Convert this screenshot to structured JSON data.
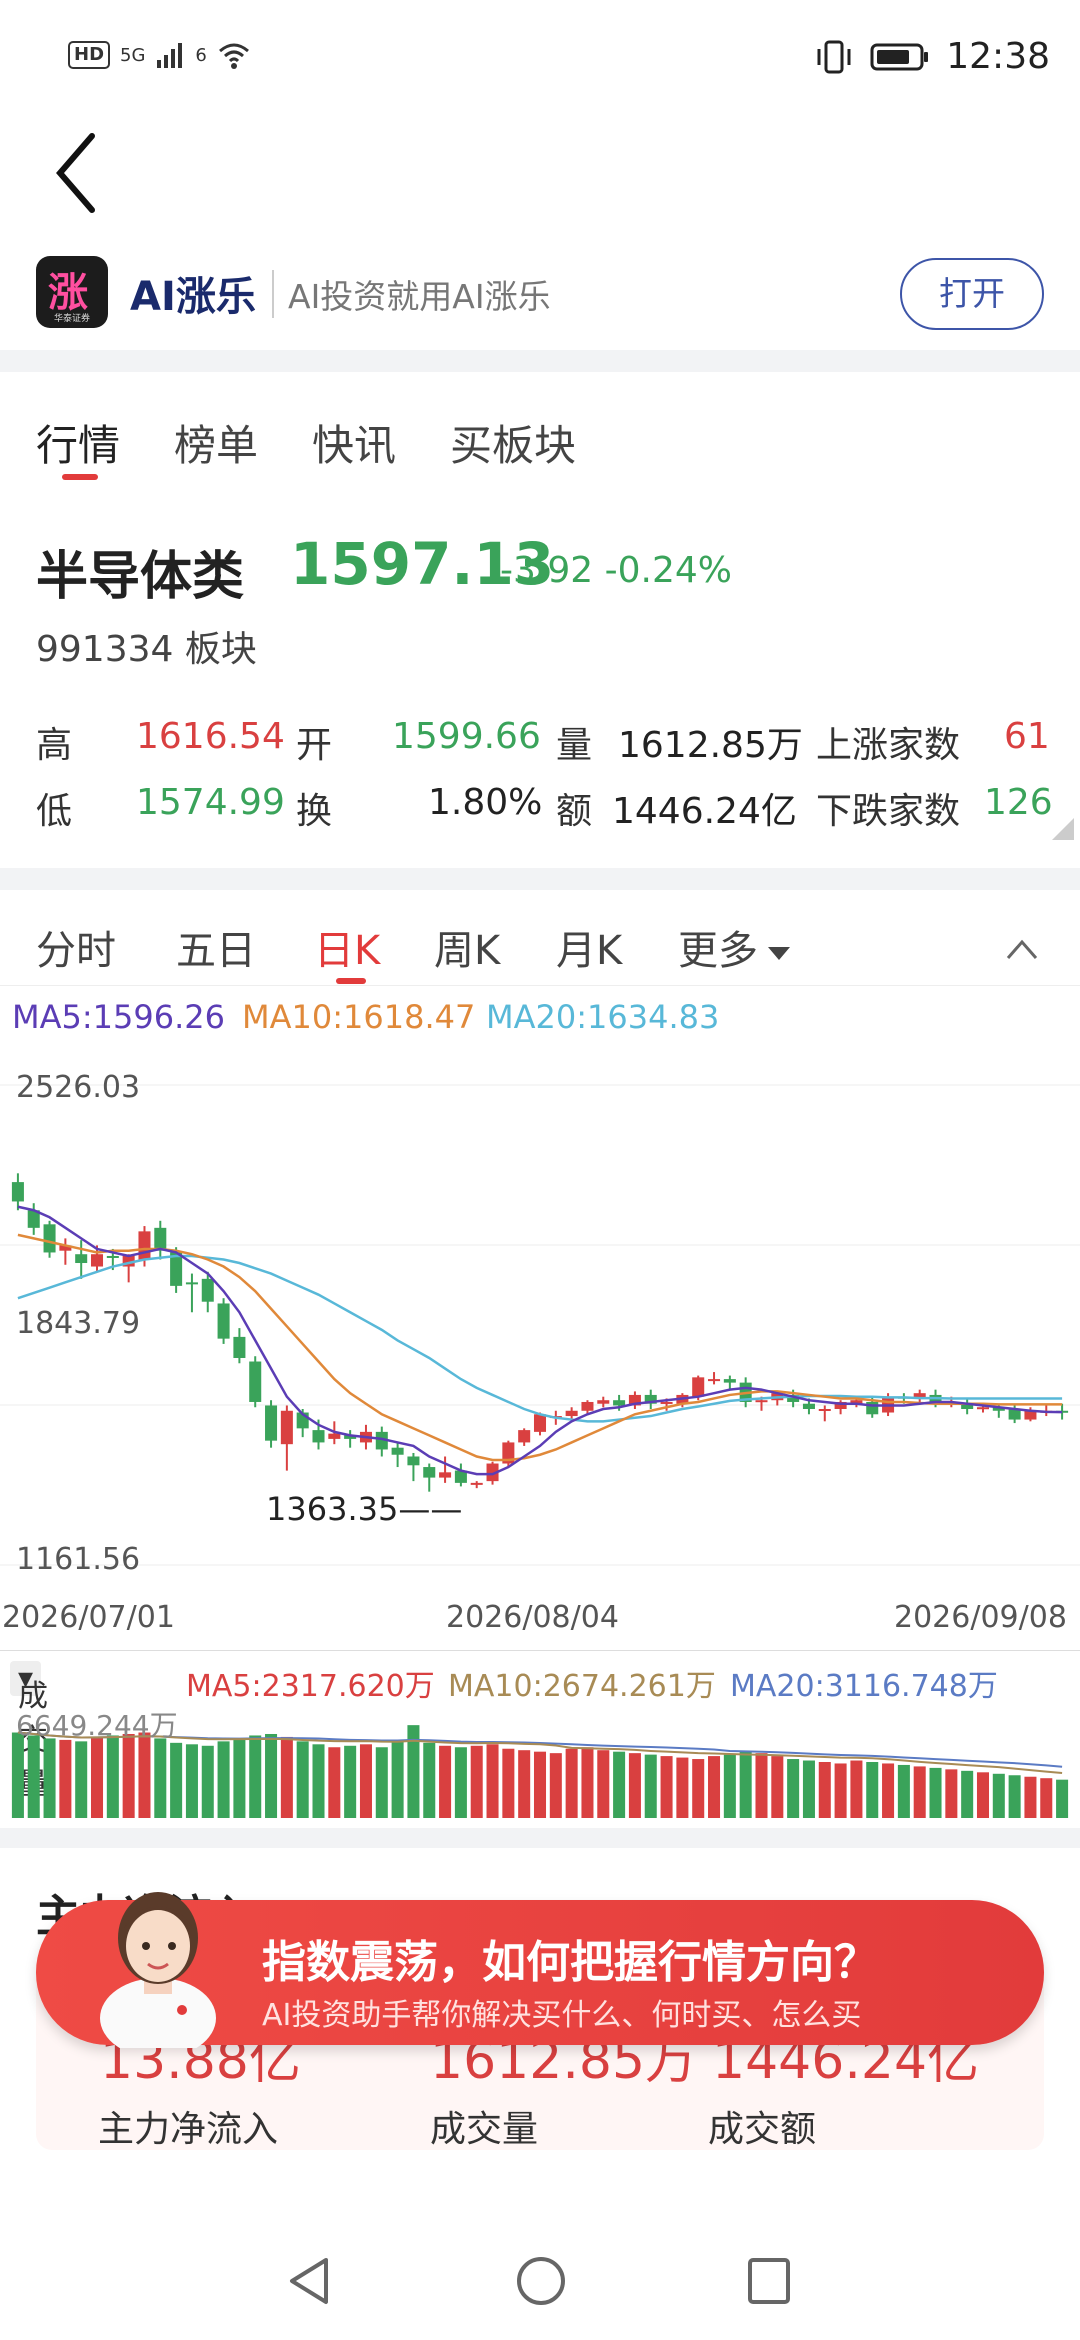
{
  "status": {
    "hd": "HD",
    "signal": "5G",
    "wifi": "6",
    "time": "12:38"
  },
  "app": {
    "name": "AI涨乐",
    "slogan": "AI投资就用AI涨乐",
    "open_label": "打开",
    "logo_glyph": "涨",
    "logo_sub": "华泰证券"
  },
  "tabs": [
    "行情",
    "榜单",
    "快讯",
    "买板块"
  ],
  "stock": {
    "name": "半导体类",
    "price": "1597.13",
    "change": "-3.92",
    "change_pct": "-0.24%",
    "code": "991334",
    "type": "板块"
  },
  "quote": {
    "high_label": "高",
    "high": "1616.54",
    "open_label": "开",
    "open": "1599.66",
    "vol_label": "量",
    "volume": "1612.85万",
    "up_label": "上涨家数",
    "up": "61",
    "low_label": "低",
    "low": "1574.99",
    "turnover_label": "换",
    "turnover": "1.80%",
    "amount_label": "额",
    "amount": "1446.24亿",
    "down_label": "下跌家数",
    "down": "126"
  },
  "kline_tabs": [
    "分时",
    "五日",
    "日K",
    "周K",
    "月K",
    "更多"
  ],
  "ma": {
    "ma5": "MA5:1596.26",
    "ma10": "MA10:1618.47",
    "ma20": "MA20:1634.83"
  },
  "colors": {
    "up": "#d94040",
    "down": "#3aa35a",
    "ma5": "#5b3db5",
    "ma10": "#e0893a",
    "ma20": "#58b8d8",
    "vma20": "#5b7bc4",
    "vma10": "#a88b55"
  },
  "chart_data": [
    {
      "type": "candlestick",
      "y_ticks": [
        "2526.03",
        "1843.79",
        "1161.56"
      ],
      "ylim": [
        1161.56,
        2526.03
      ],
      "x_ticks": [
        "2026/07/01",
        "2026/08/04",
        "2026/09/08"
      ],
      "low_annotation": "1363.35",
      "candles": [
        [
          2250,
          2195,
          2170,
          2275
        ],
        [
          2170,
          2120,
          2100,
          2190
        ],
        [
          2130,
          2050,
          2035,
          2140
        ],
        [
          2055,
          2070,
          2015,
          2090
        ],
        [
          2045,
          2020,
          1975,
          2085
        ],
        [
          2010,
          2045,
          1995,
          2070
        ],
        [
          2040,
          2035,
          2000,
          2060
        ],
        [
          2010,
          2040,
          1965,
          2045
        ],
        [
          2030,
          2110,
          2010,
          2125
        ],
        [
          2120,
          2055,
          2030,
          2140
        ],
        [
          2050,
          1955,
          1935,
          2065
        ],
        [
          1965,
          1960,
          1880,
          1990
        ],
        [
          1975,
          1910,
          1880,
          1995
        ],
        [
          1905,
          1805,
          1790,
          1920
        ],
        [
          1810,
          1750,
          1735,
          1835
        ],
        [
          1740,
          1625,
          1610,
          1755
        ],
        [
          1615,
          1515,
          1495,
          1630
        ],
        [
          1505,
          1600,
          1430,
          1615
        ],
        [
          1595,
          1550,
          1525,
          1605
        ],
        [
          1545,
          1510,
          1490,
          1575
        ],
        [
          1520,
          1535,
          1505,
          1570
        ],
        [
          1530,
          1520,
          1495,
          1545
        ],
        [
          1510,
          1540,
          1490,
          1560
        ],
        [
          1540,
          1490,
          1470,
          1555
        ],
        [
          1495,
          1475,
          1440,
          1510
        ],
        [
          1470,
          1445,
          1400,
          1480
        ],
        [
          1440,
          1410,
          1370,
          1450
        ],
        [
          1410,
          1425,
          1395,
          1470
        ],
        [
          1430,
          1395,
          1385,
          1450
        ],
        [
          1390,
          1395,
          1380,
          1400
        ],
        [
          1400,
          1450,
          1390,
          1455
        ],
        [
          1450,
          1510,
          1440,
          1515
        ],
        [
          1510,
          1545,
          1500,
          1550
        ],
        [
          1540,
          1590,
          1530,
          1595
        ],
        [
          1585,
          1585,
          1560,
          1600
        ],
        [
          1585,
          1600,
          1570,
          1610
        ],
        [
          1600,
          1625,
          1590,
          1630
        ],
        [
          1620,
          1630,
          1610,
          1640
        ],
        [
          1630,
          1615,
          1600,
          1645
        ],
        [
          1615,
          1645,
          1605,
          1655
        ],
        [
          1645,
          1620,
          1605,
          1660
        ],
        [
          1620,
          1625,
          1600,
          1635
        ],
        [
          1620,
          1645,
          1610,
          1650
        ],
        [
          1640,
          1695,
          1630,
          1700
        ],
        [
          1690,
          1690,
          1675,
          1710
        ],
        [
          1690,
          1680,
          1660,
          1700
        ],
        [
          1680,
          1625,
          1610,
          1695
        ],
        [
          1625,
          1630,
          1600,
          1640
        ],
        [
          1630,
          1650,
          1615,
          1655
        ],
        [
          1645,
          1625,
          1610,
          1660
        ],
        [
          1620,
          1605,
          1590,
          1635
        ],
        [
          1600,
          1605,
          1570,
          1615
        ],
        [
          1605,
          1625,
          1590,
          1630
        ],
        [
          1620,
          1630,
          1610,
          1640
        ],
        [
          1625,
          1590,
          1580,
          1640
        ],
        [
          1595,
          1640,
          1585,
          1650
        ],
        [
          1640,
          1635,
          1620,
          1650
        ],
        [
          1635,
          1650,
          1620,
          1660
        ],
        [
          1645,
          1625,
          1610,
          1660
        ],
        [
          1625,
          1625,
          1610,
          1640
        ],
        [
          1620,
          1605,
          1590,
          1635
        ],
        [
          1610,
          1610,
          1595,
          1620
        ],
        [
          1610,
          1600,
          1580,
          1620
        ],
        [
          1605,
          1575,
          1565,
          1615
        ],
        [
          1575,
          1600,
          1570,
          1610
        ],
        [
          1600,
          1600,
          1585,
          1615
        ],
        [
          1600,
          1595,
          1575,
          1620
        ]
      ],
      "ma5": [
        2180,
        2170,
        2150,
        2120,
        2090,
        2060,
        2050,
        2040,
        2050,
        2060,
        2050,
        2020,
        1990,
        1940,
        1880,
        1800,
        1720,
        1640,
        1590,
        1560,
        1540,
        1530,
        1525,
        1520,
        1510,
        1500,
        1470,
        1450,
        1430,
        1420,
        1420,
        1440,
        1470,
        1500,
        1540,
        1570,
        1590,
        1605,
        1610,
        1620,
        1625,
        1630,
        1635,
        1640,
        1650,
        1660,
        1665,
        1660,
        1650,
        1640,
        1630,
        1625,
        1620,
        1620,
        1615,
        1615,
        1615,
        1620,
        1625,
        1625,
        1620,
        1615,
        1610,
        1605,
        1600,
        1597,
        1596
      ],
      "ma10": [
        2100,
        2090,
        2080,
        2070,
        2060,
        2050,
        2055,
        2055,
        2060,
        2060,
        2055,
        2045,
        2030,
        2010,
        1980,
        1940,
        1890,
        1840,
        1790,
        1740,
        1690,
        1650,
        1620,
        1590,
        1570,
        1550,
        1530,
        1510,
        1490,
        1470,
        1460,
        1460,
        1465,
        1475,
        1490,
        1510,
        1530,
        1550,
        1570,
        1590,
        1600,
        1610,
        1620,
        1625,
        1635,
        1645,
        1650,
        1655,
        1655,
        1650,
        1645,
        1640,
        1635,
        1635,
        1630,
        1625,
        1625,
        1622,
        1620,
        1620,
        1620,
        1620,
        1618,
        1618,
        1618,
        1618,
        1618
      ],
      "ma20": [
        1920,
        1935,
        1950,
        1965,
        1980,
        1995,
        2010,
        2020,
        2030,
        2035,
        2040,
        2040,
        2035,
        2030,
        2020,
        2005,
        1990,
        1970,
        1950,
        1930,
        1905,
        1880,
        1855,
        1830,
        1800,
        1775,
        1750,
        1720,
        1690,
        1665,
        1645,
        1625,
        1605,
        1590,
        1580,
        1575,
        1570,
        1570,
        1575,
        1580,
        1585,
        1595,
        1605,
        1612,
        1620,
        1628,
        1632,
        1635,
        1638,
        1640,
        1642,
        1642,
        1642,
        1640,
        1640,
        1638,
        1638,
        1636,
        1636,
        1635,
        1635,
        1635,
        1635,
        1635,
        1635,
        1635,
        1635
      ]
    },
    {
      "type": "bar",
      "label": "成交量",
      "max_label": "6649.244万",
      "ma": {
        "ma5": "MA5:2317.620万",
        "ma10": "MA10:2674.261万",
        "ma20": "MA20:3116.748万"
      },
      "ylim": [
        0,
        6649.244
      ],
      "values": [
        5800,
        5600,
        5400,
        5300,
        5200,
        5500,
        5600,
        5700,
        5800,
        5400,
        5100,
        5000,
        4900,
        5200,
        5300,
        5600,
        5700,
        5500,
        5200,
        5000,
        4800,
        4900,
        5000,
        4800,
        5200,
        6300,
        5100,
        4900,
        4800,
        4900,
        5000,
        4700,
        4600,
        4500,
        4400,
        4700,
        4800,
        4600,
        4500,
        4400,
        4300,
        4200,
        4100,
        4000,
        4200,
        4300,
        4500,
        4400,
        4200,
        4000,
        3900,
        3800,
        3700,
        3900,
        3800,
        3700,
        3600,
        3500,
        3400,
        3300,
        3200,
        3100,
        3000,
        2900,
        2800,
        2700,
        2600
      ]
    }
  ],
  "flow": {
    "title": "主力净流入",
    "vals": [
      "13.88亿",
      "1612.85万",
      "1446.24亿"
    ],
    "labels": [
      "主力净流入",
      "成交量",
      "成交额"
    ]
  },
  "promo": {
    "title": "指数震荡，如何把握行情方向？",
    "subtitle": "AI投资助手帮你解决买什么、何时买、怎么买"
  }
}
